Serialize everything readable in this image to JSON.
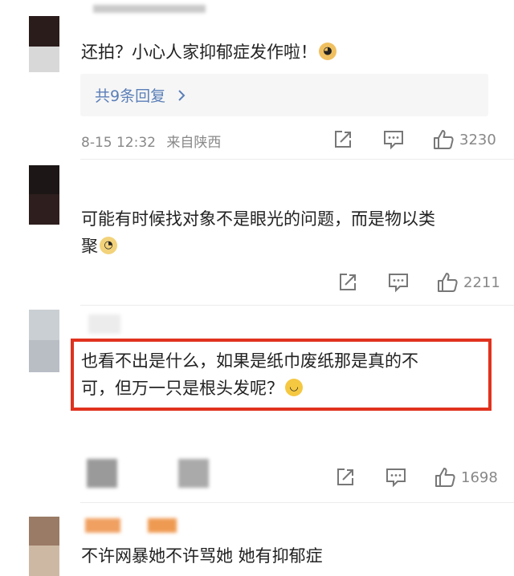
{
  "comments": [
    {
      "text": "还拍？小心人家抑郁症发作啦！",
      "emoji": "doge",
      "replies_label": "共9条回复",
      "time": "8-15 12:32",
      "location": "来自陕西",
      "likes": "3230"
    },
    {
      "text_line1": "可能有时候找对象不是眼光的问题，而是物以类",
      "text_line2": "聚",
      "emoji": "sweat",
      "likes": "2211"
    },
    {
      "text_line1": "也看不出是什么，如果是纸巾废纸那是真的不",
      "text_line2": "可，但万一只是根头发呢？",
      "emoji": "shrug",
      "likes": "1698"
    },
    {
      "text": "不许网暴她不许骂她 她有抑郁症"
    }
  ],
  "icons": {
    "share": "share-icon",
    "comment": "comment-icon",
    "like": "like-icon",
    "chevron": "chevron-right-icon"
  },
  "colors": {
    "highlight_border": "#e0321e",
    "link": "#5b7fb8",
    "meta": "#888888"
  }
}
